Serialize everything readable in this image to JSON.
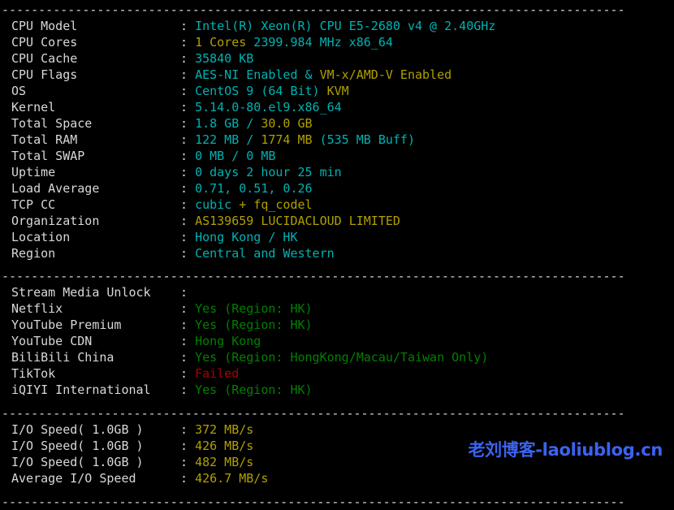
{
  "terminal": {
    "background": "#000000",
    "label_color": "#d8d8d8",
    "colors": {
      "cyan": "#00b2b2",
      "yellow": "#b0a000",
      "green": "#008000",
      "red": "#aa0000",
      "white": "#d8d8d8",
      "watermark_blue": "#3b63f0"
    },
    "separator": "-------------------------------------------------------------------------------------",
    "colon": ":"
  },
  "system_info": [
    {
      "label": "CPU Model",
      "parts": [
        {
          "text": "Intel(R) Xeon(R) CPU E5-2680 v4 @ 2.40GHz",
          "color": "cyan"
        }
      ]
    },
    {
      "label": "CPU Cores",
      "parts": [
        {
          "text": "1 Cores",
          "color": "yellow"
        },
        {
          "text": " 2399.984 MHz x86_64",
          "color": "cyan"
        }
      ]
    },
    {
      "label": "CPU Cache",
      "parts": [
        {
          "text": "35840 KB",
          "color": "cyan"
        }
      ]
    },
    {
      "label": "CPU Flags",
      "parts": [
        {
          "text": "AES-NI Enabled",
          "color": "cyan"
        },
        {
          "text": " & ",
          "color": "cyan"
        },
        {
          "text": "VM-x/AMD-V Enabled",
          "color": "yellow"
        }
      ]
    },
    {
      "label": "OS",
      "parts": [
        {
          "text": "CentOS 9 (64 Bit) ",
          "color": "cyan"
        },
        {
          "text": "KVM",
          "color": "yellow"
        }
      ]
    },
    {
      "label": "Kernel",
      "parts": [
        {
          "text": "5.14.0-80.el9.x86_64",
          "color": "cyan"
        }
      ]
    },
    {
      "label": "Total Space",
      "parts": [
        {
          "text": "1.8 GB",
          "color": "cyan"
        },
        {
          "text": " / ",
          "color": "cyan"
        },
        {
          "text": "30.0 GB",
          "color": "yellow"
        }
      ]
    },
    {
      "label": "Total RAM",
      "parts": [
        {
          "text": "122 MB",
          "color": "cyan"
        },
        {
          "text": " / ",
          "color": "cyan"
        },
        {
          "text": "1774 MB",
          "color": "yellow"
        },
        {
          "text": " (535 MB Buff)",
          "color": "cyan"
        }
      ]
    },
    {
      "label": "Total SWAP",
      "parts": [
        {
          "text": "0 MB / 0 MB",
          "color": "cyan"
        }
      ]
    },
    {
      "label": "Uptime",
      "parts": [
        {
          "text": "0 days 2 hour 25 min",
          "color": "cyan"
        }
      ]
    },
    {
      "label": "Load Average",
      "parts": [
        {
          "text": "0.71, 0.51, 0.26",
          "color": "cyan"
        }
      ]
    },
    {
      "label": "TCP CC",
      "parts": [
        {
          "text": "cubic",
          "color": "cyan"
        },
        {
          "text": " + fq_codel",
          "color": "yellow"
        }
      ]
    },
    {
      "label": "Organization",
      "parts": [
        {
          "text": "AS139659 LUCIDACLOUD LIMITED",
          "color": "yellow"
        }
      ]
    },
    {
      "label": "Location",
      "parts": [
        {
          "text": "Hong Kong / HK",
          "color": "cyan"
        }
      ]
    },
    {
      "label": "Region",
      "parts": [
        {
          "text": "Central and Western",
          "color": "cyan"
        }
      ]
    }
  ],
  "stream_media": [
    {
      "label": "Stream Media Unlock",
      "parts": [
        {
          "text": "",
          "color": "white"
        }
      ]
    },
    {
      "label": "Netflix",
      "parts": [
        {
          "text": "Yes (Region: HK)",
          "color": "green"
        }
      ]
    },
    {
      "label": "YouTube Premium",
      "parts": [
        {
          "text": "Yes (Region: HK)",
          "color": "green"
        }
      ]
    },
    {
      "label": "YouTube CDN",
      "parts": [
        {
          "text": "Hong Kong",
          "color": "green"
        }
      ]
    },
    {
      "label": "BiliBili China",
      "parts": [
        {
          "text": "Yes (Region: HongKong/Macau/Taiwan Only)",
          "color": "green"
        }
      ]
    },
    {
      "label": "TikTok",
      "parts": [
        {
          "text": "Failed",
          "color": "red"
        }
      ]
    },
    {
      "label": "iQIYI International",
      "parts": [
        {
          "text": "Yes (Region: HK)",
          "color": "green"
        }
      ]
    }
  ],
  "io_speed": [
    {
      "label": "I/O Speed( 1.0GB )",
      "parts": [
        {
          "text": "372 MB/s",
          "color": "yellow"
        }
      ]
    },
    {
      "label": "I/O Speed( 1.0GB )",
      "parts": [
        {
          "text": "426 MB/s",
          "color": "yellow"
        }
      ]
    },
    {
      "label": "I/O Speed( 1.0GB )",
      "parts": [
        {
          "text": "482 MB/s",
          "color": "yellow"
        }
      ]
    },
    {
      "label": "Average I/O Speed",
      "parts": [
        {
          "text": "426.7 MB/s",
          "color": "yellow"
        }
      ]
    }
  ],
  "watermark": {
    "text": "老刘博客-laoliublog.cn"
  }
}
